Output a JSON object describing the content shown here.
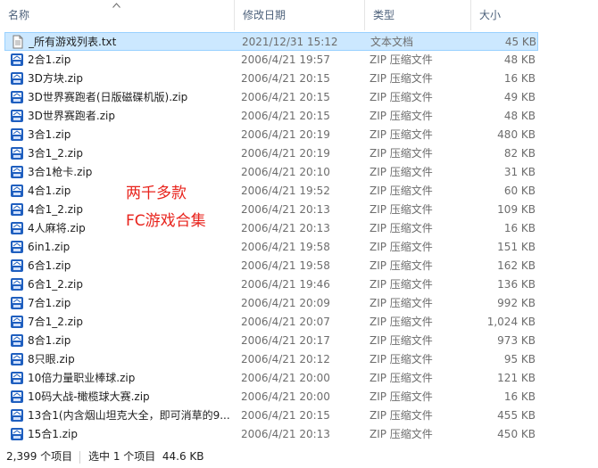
{
  "header": {
    "col_name": "名称",
    "col_date": "修改日期",
    "col_type": "类型",
    "col_size": "大小",
    "sort_indicator": "^"
  },
  "files": [
    {
      "name": "_所有游戏列表.txt",
      "date": "2021/12/31 15:12",
      "type": "文本文档",
      "size": "45 KB",
      "icon": "text-file-icon",
      "selected": true
    },
    {
      "name": "2合1.zip",
      "date": "2006/4/21 19:57",
      "type": "ZIP 压缩文件",
      "size": "48 KB",
      "icon": "zip-file-icon"
    },
    {
      "name": "3D方块.zip",
      "date": "2006/4/21 20:15",
      "type": "ZIP 压缩文件",
      "size": "16 KB",
      "icon": "zip-file-icon"
    },
    {
      "name": "3D世界赛跑者(日版磁碟机版).zip",
      "date": "2006/4/21 20:15",
      "type": "ZIP 压缩文件",
      "size": "49 KB",
      "icon": "zip-file-icon"
    },
    {
      "name": "3D世界赛跑者.zip",
      "date": "2006/4/21 20:15",
      "type": "ZIP 压缩文件",
      "size": "48 KB",
      "icon": "zip-file-icon"
    },
    {
      "name": "3合1.zip",
      "date": "2006/4/21 20:19",
      "type": "ZIP 压缩文件",
      "size": "480 KB",
      "icon": "zip-file-icon"
    },
    {
      "name": "3合1_2.zip",
      "date": "2006/4/21 20:19",
      "type": "ZIP 压缩文件",
      "size": "82 KB",
      "icon": "zip-file-icon"
    },
    {
      "name": "3合1枪卡.zip",
      "date": "2006/4/21 20:10",
      "type": "ZIP 压缩文件",
      "size": "31 KB",
      "icon": "zip-file-icon"
    },
    {
      "name": "4合1.zip",
      "date": "2006/4/21 19:52",
      "type": "ZIP 压缩文件",
      "size": "60 KB",
      "icon": "zip-file-icon"
    },
    {
      "name": "4合1_2.zip",
      "date": "2006/4/21 20:13",
      "type": "ZIP 压缩文件",
      "size": "109 KB",
      "icon": "zip-file-icon"
    },
    {
      "name": "4人麻将.zip",
      "date": "2006/4/21 20:13",
      "type": "ZIP 压缩文件",
      "size": "16 KB",
      "icon": "zip-file-icon"
    },
    {
      "name": "6in1.zip",
      "date": "2006/4/21 19:58",
      "type": "ZIP 压缩文件",
      "size": "151 KB",
      "icon": "zip-file-icon"
    },
    {
      "name": "6合1.zip",
      "date": "2006/4/21 19:58",
      "type": "ZIP 压缩文件",
      "size": "162 KB",
      "icon": "zip-file-icon"
    },
    {
      "name": "6合1_2.zip",
      "date": "2006/4/21 19:46",
      "type": "ZIP 压缩文件",
      "size": "136 KB",
      "icon": "zip-file-icon"
    },
    {
      "name": "7合1.zip",
      "date": "2006/4/21 20:09",
      "type": "ZIP 压缩文件",
      "size": "992 KB",
      "icon": "zip-file-icon"
    },
    {
      "name": "7合1_2.zip",
      "date": "2006/4/21 20:07",
      "type": "ZIP 压缩文件",
      "size": "1,024 KB",
      "icon": "zip-file-icon"
    },
    {
      "name": "8合1.zip",
      "date": "2006/4/21 20:17",
      "type": "ZIP 压缩文件",
      "size": "973 KB",
      "icon": "zip-file-icon"
    },
    {
      "name": "8只眼.zip",
      "date": "2006/4/21 20:12",
      "type": "ZIP 压缩文件",
      "size": "95 KB",
      "icon": "zip-file-icon"
    },
    {
      "name": "10倍力量职业棒球.zip",
      "date": "2006/4/21 20:00",
      "type": "ZIP 压缩文件",
      "size": "121 KB",
      "icon": "zip-file-icon"
    },
    {
      "name": "10码大战-橄榄球大赛.zip",
      "date": "2006/4/21 20:00",
      "type": "ZIP 压缩文件",
      "size": "16 KB",
      "icon": "zip-file-icon"
    },
    {
      "name": "13合1(内含烟山坦克大全，即可消草的9...",
      "date": "2006/4/21 20:15",
      "type": "ZIP 压缩文件",
      "size": "455 KB",
      "icon": "zip-file-icon"
    },
    {
      "name": "15合1.zip",
      "date": "2006/4/21 20:13",
      "type": "ZIP 压缩文件",
      "size": "450 KB",
      "icon": "zip-file-icon"
    }
  ],
  "overlay": {
    "line1": "两千多款",
    "line2": "FC游戏合集",
    "color": "#e8231c"
  },
  "status": {
    "item_count": "2,399 个项目",
    "selection": "选中 1 个项目  44.6 KB"
  },
  "colors": {
    "selected_bg": "#cce8ff",
    "selected_border": "#99d1ff",
    "header_text": "#4c607a",
    "zip_icon_blue": "#1f5fbf"
  }
}
